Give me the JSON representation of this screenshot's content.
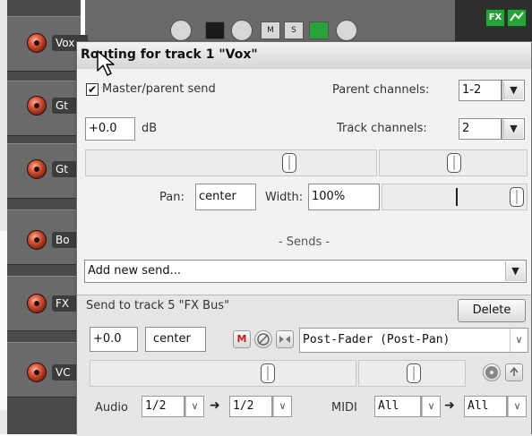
{
  "tracks": [
    {
      "name": "Vox"
    },
    {
      "name": "Gt"
    },
    {
      "name": "Gt"
    },
    {
      "name": "Bo"
    },
    {
      "name": "FX"
    },
    {
      "name": "VC"
    }
  ],
  "top_right_icons": [
    {
      "label": "FX",
      "icon": "fx-icon"
    },
    {
      "label": "",
      "icon": "envelope-icon"
    }
  ],
  "window": {
    "title": "Routing for track 1 \"Vox\""
  },
  "master_send": {
    "checked": "✔",
    "label": "Master/parent send",
    "parent_channels_label": "Parent channels:",
    "parent_channels_value": "1-2"
  },
  "volume": {
    "value": "+0.0",
    "unit": "dB",
    "track_channels_label": "Track channels:",
    "track_channels_value": "2"
  },
  "pan": {
    "pan_label": "Pan:",
    "pan_value": "center",
    "width_label": "Width:",
    "width_value": "100%"
  },
  "sends": {
    "separator_label": "- Sends -",
    "add_new_send": "Add new send..."
  },
  "send1": {
    "title": "Send to track 5 \"FX Bus\"",
    "delete_label": "Delete",
    "volume_value": "+0.0",
    "pan_value": "center",
    "mute_label": "M",
    "phase_icon": "phase-icon",
    "mono_icon": "mono-icon",
    "mode": "Post-Fader (Post-Pan)",
    "audio_label": "Audio",
    "audio_src": "1/2",
    "audio_dst": "1/2",
    "midi_label": "MIDI",
    "midi_src": "All",
    "midi_dst": "All"
  },
  "colors": {
    "track_bg": "#6a6a6a",
    "window_bg": "#ececec",
    "fx_green": "#27a33a",
    "rec_arm": "#d8553a"
  }
}
